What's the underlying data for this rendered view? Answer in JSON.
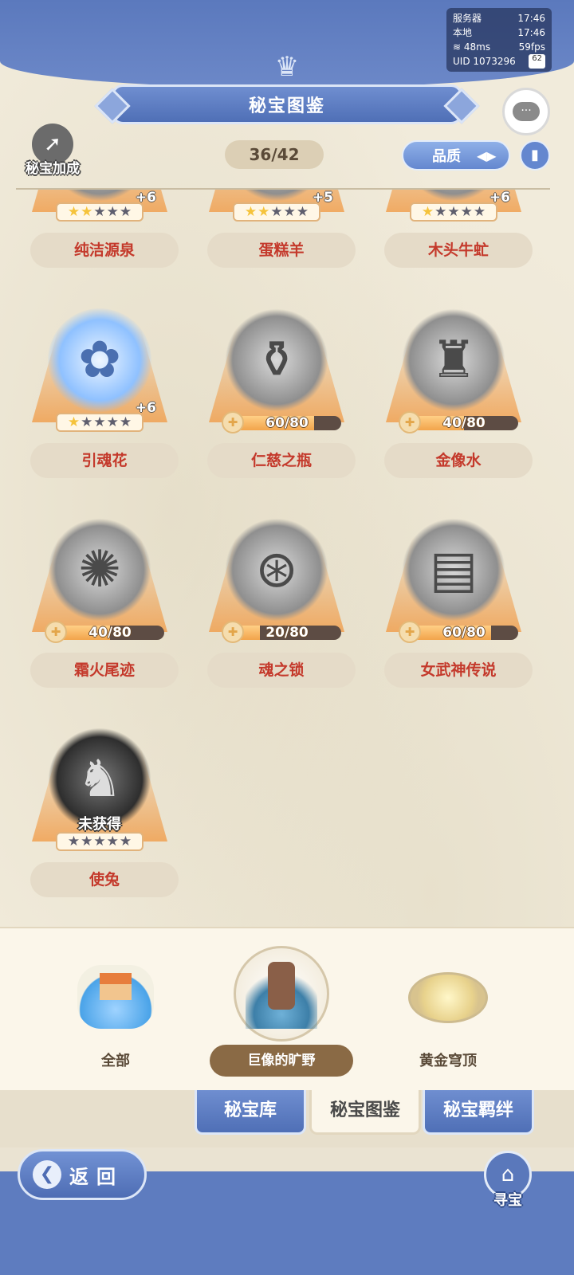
{
  "status": {
    "server_label": "服务器",
    "server_time": "17:46",
    "local_label": "本地",
    "local_time": "17:46",
    "ping": "48ms",
    "fps": "59fps",
    "uid": "UID 1073296",
    "battery": "62"
  },
  "header": {
    "title": "秘宝图鉴",
    "bonus_label": "秘宝加成",
    "counter": "36/42",
    "sort_label": "品质",
    "sort_icon": "up-down-arrows-icon",
    "book_icon": "book-icon",
    "chat_icon": "chat-bubbles-icon"
  },
  "items": [
    {
      "name": "纯洁源泉",
      "plus": "+6",
      "stars": 2,
      "max_stars": 5,
      "art": "spring-fountain",
      "col": 0,
      "row": 0
    },
    {
      "name": "蛋糕羊",
      "plus": "+5",
      "stars": 2,
      "max_stars": 5,
      "art": "cake-sheep",
      "col": 1,
      "row": 0
    },
    {
      "name": "木头牛虻",
      "plus": "+6",
      "stars": 1,
      "max_stars": 5,
      "art": "wooden-gadfly",
      "col": 2,
      "row": 0
    },
    {
      "name": "引魂花",
      "plus": "+6",
      "stars": 1,
      "max_stars": 5,
      "art": "soul-flower",
      "col": 0,
      "row": 1
    },
    {
      "name": "仁慈之瓶",
      "progress": "60/80",
      "progress_value": 0.75,
      "art": "mercy-bottle",
      "col": 1,
      "row": 1
    },
    {
      "name": "金像水",
      "progress": "40/80",
      "progress_value": 0.5,
      "art": "statue-water",
      "col": 2,
      "row": 1
    },
    {
      "name": "霜火尾迹",
      "progress": "40/80",
      "progress_value": 0.5,
      "art": "frostfire-trail",
      "col": 0,
      "row": 2
    },
    {
      "name": "魂之锁",
      "progress": "20/80",
      "progress_value": 0.25,
      "art": "soul-lock",
      "col": 1,
      "row": 2
    },
    {
      "name": "女武神传说",
      "progress": "60/80",
      "progress_value": 0.75,
      "art": "valkyrie-book",
      "col": 2,
      "row": 2
    },
    {
      "name": "使兔",
      "unobtained": "未获得",
      "stars": 0,
      "max_stars": 5,
      "art": "messenger-beast",
      "col": 0,
      "row": 3
    }
  ],
  "regions": [
    {
      "label": "全部",
      "icon": "island-house-icon",
      "active": false
    },
    {
      "label": "巨像的旷野",
      "icon": "colossus-wilds-icon",
      "active": true
    },
    {
      "label": "黄金穹顶",
      "icon": "golden-dome-icon",
      "active": false
    }
  ],
  "tabs": [
    {
      "label": "秘宝库",
      "active": false
    },
    {
      "label": "秘宝图鉴",
      "active": true
    },
    {
      "label": "秘宝羁绊",
      "active": false
    }
  ],
  "footer": {
    "back_label": "返回",
    "treasure_label": "寻宝"
  },
  "colors": {
    "primary_blue": "#5e7cbf",
    "name_red": "#c4392b",
    "star_gold": "#f5c33b",
    "progress_orange": "#f2a44b",
    "parchment": "#f1ebdb"
  }
}
